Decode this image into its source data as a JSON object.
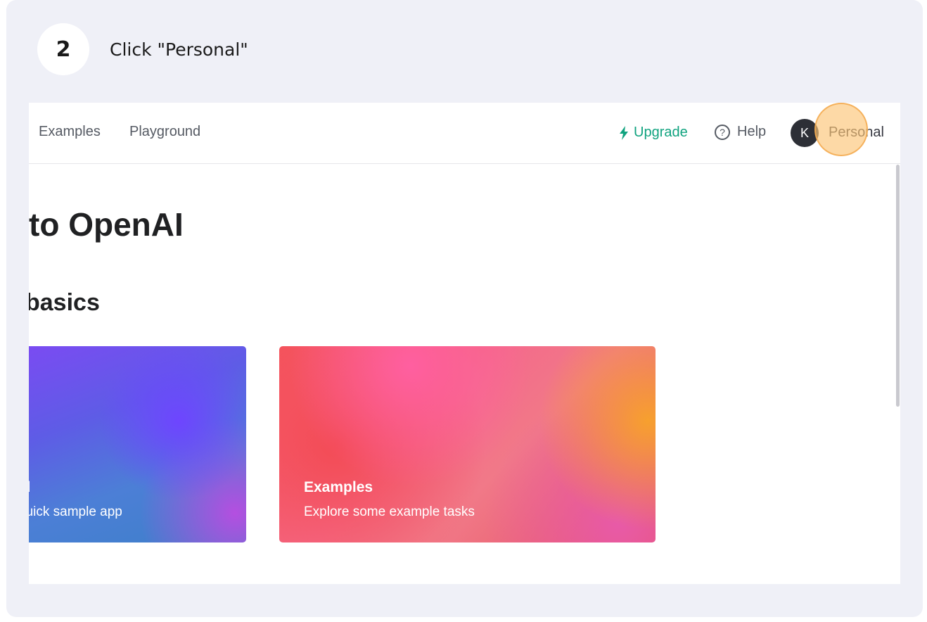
{
  "step": {
    "number": "2",
    "instruction": "Click \"Personal\""
  },
  "topbar": {
    "nav": [
      {
        "label": "Examples"
      },
      {
        "label": "Playground"
      }
    ],
    "upgrade_label": "Upgrade",
    "help_label": "Help",
    "help_icon_glyph": "?",
    "avatar_initial": "K",
    "org_label": "Personal"
  },
  "main": {
    "welcome_heading": "to OpenAI",
    "basics_heading": "basics",
    "tiles": [
      {
        "title": "al",
        "subtitle": "quick sample app"
      },
      {
        "title": "Examples",
        "subtitle": "Explore some example tasks"
      }
    ]
  },
  "colors": {
    "accent_green": "#10a37f",
    "highlight": "#fcc476"
  }
}
